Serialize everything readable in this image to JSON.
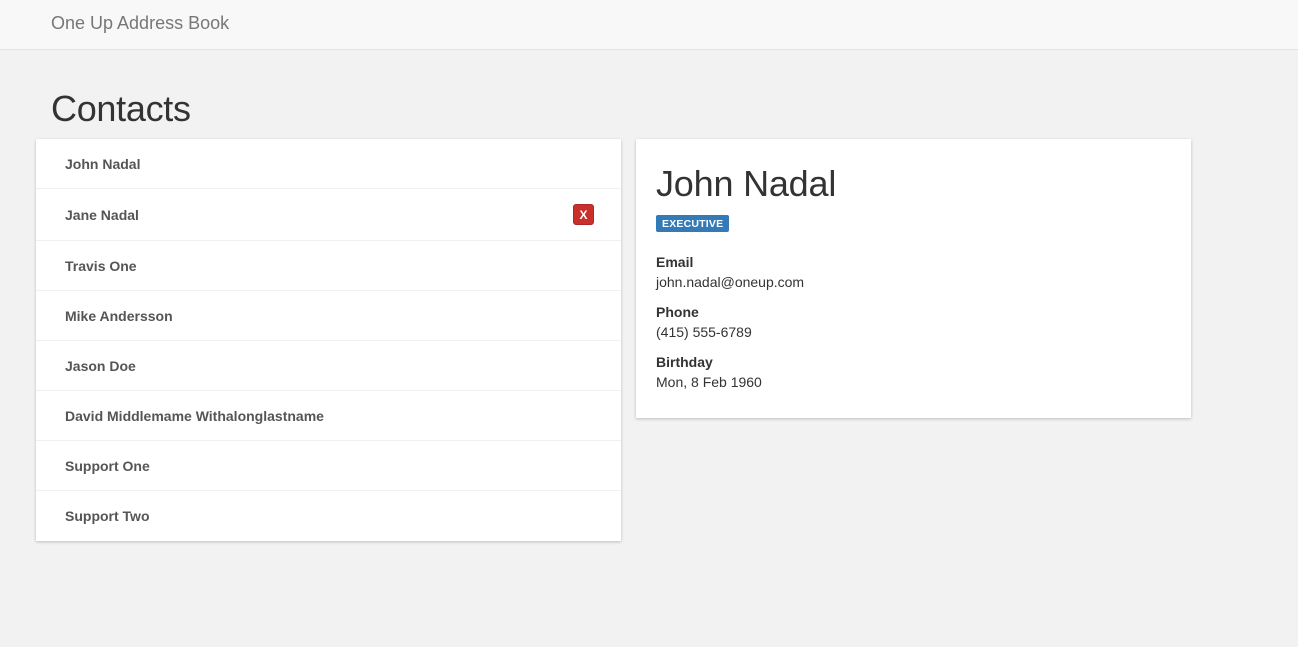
{
  "navbar": {
    "brand": "One Up Address Book"
  },
  "page": {
    "title": "Contacts"
  },
  "contacts": [
    {
      "name": "John Nadal"
    },
    {
      "name": "Jane Nadal",
      "delete_label": "X"
    },
    {
      "name": "Travis One"
    },
    {
      "name": "Mike Andersson"
    },
    {
      "name": "Jason Doe"
    },
    {
      "name": "David Middlemame Withalonglastname"
    },
    {
      "name": "Support One"
    },
    {
      "name": "Support Two"
    }
  ],
  "detail": {
    "name": "John Nadal",
    "badge": "EXECUTIVE",
    "fields": [
      {
        "label": "Email",
        "value": "john.nadal@oneup.com"
      },
      {
        "label": "Phone",
        "value": "(415) 555-6789"
      },
      {
        "label": "Birthday",
        "value": "Mon, 8 Feb 1960"
      }
    ]
  },
  "colors": {
    "badge": "#337ab7",
    "delete": "#c9302c",
    "background": "#f2f2f2"
  }
}
